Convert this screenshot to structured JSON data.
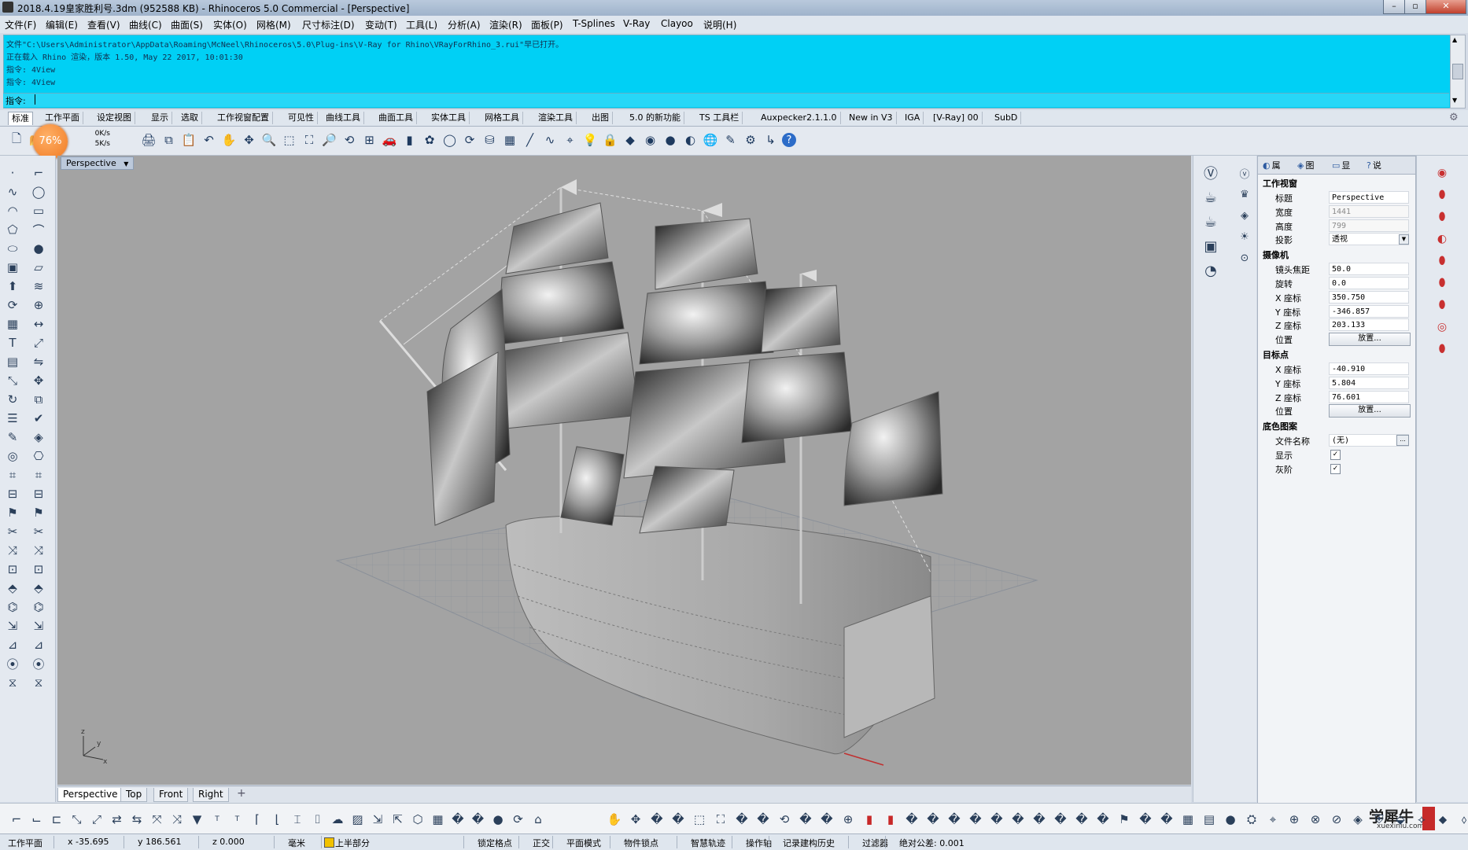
{
  "window": {
    "title": "2018.4.19皇家胜利号.3dm (952588 KB) - Rhinoceros 5.0 Commercial - [Perspective]",
    "controls": [
      "–",
      "▫",
      "✕"
    ]
  },
  "menu": [
    "文件(F)",
    "编辑(E)",
    "查看(V)",
    "曲线(C)",
    "曲面(S)",
    "实体(O)",
    "网格(M)",
    "尺寸标注(D)",
    "变动(T)",
    "工具(L)",
    "分析(A)",
    "渲染(R)",
    "面板(P)",
    "T-Splines",
    "V-Ray",
    "Clayoo",
    "说明(H)"
  ],
  "command": {
    "history": [
      "文件\"C:\\Users\\Administrator\\AppData\\Roaming\\McNeel\\Rhinoceros\\5.0\\Plug-ins\\V-Ray for Rhino\\VRayForRhino_3.rui\"早已打开。",
      "正在载入 Rhino 渲染，版本 1.50, May 22 2017, 10:01:30",
      "指令: 4View",
      "指令: 4View"
    ],
    "prompt": "指令:"
  },
  "toolbar_tabs": [
    "标准",
    "工作平面",
    "设定视图",
    "显示",
    "选取",
    "工作视窗配置",
    "可见性",
    "曲线工具",
    "曲面工具",
    "实体工具",
    "网格工具",
    "渲染工具",
    "出图",
    "5.0 的新功能",
    "TS 工具栏",
    "Auxpecker2.1.1.0",
    "New in V3",
    "IGA",
    "[V-Ray] 00",
    "SubD"
  ],
  "active_tab": "标准",
  "net_speed": {
    "up": "0K/s",
    "down": "5K/s"
  },
  "gpu_badge": "76%",
  "viewport": {
    "label": "Perspective",
    "tabs": [
      "Perspective",
      "Top",
      "Front",
      "Right"
    ],
    "active": "Perspective",
    "axis_labels": {
      "z": "z",
      "y": "y",
      "x": "x"
    }
  },
  "properties": {
    "tabs": [
      "属",
      "图",
      "显",
      "说"
    ],
    "sections": [
      {
        "title": "工作视窗",
        "rows": [
          {
            "key": "标题",
            "value": "Perspective",
            "kind": "text"
          },
          {
            "key": "宽度",
            "value": "1441",
            "kind": "gray"
          },
          {
            "key": "高度",
            "value": "799",
            "kind": "gray"
          },
          {
            "key": "投影",
            "value": "透视",
            "kind": "select"
          }
        ]
      },
      {
        "title": "摄像机",
        "rows": [
          {
            "key": "镜头焦距",
            "value": "50.0",
            "kind": "text"
          },
          {
            "key": "旋转",
            "value": "0.0",
            "kind": "text"
          },
          {
            "key": "X 座标",
            "value": "350.750",
            "kind": "text"
          },
          {
            "key": "Y 座标",
            "value": "-346.857",
            "kind": "text"
          },
          {
            "key": "Z 座标",
            "value": "203.133",
            "kind": "text"
          },
          {
            "key": "位置",
            "value": "放置...",
            "kind": "button"
          }
        ]
      },
      {
        "title": "目标点",
        "rows": [
          {
            "key": "X 座标",
            "value": "-40.910",
            "kind": "text"
          },
          {
            "key": "Y 座标",
            "value": "5.804",
            "kind": "text"
          },
          {
            "key": "Z 座标",
            "value": "76.601",
            "kind": "text"
          },
          {
            "key": "位置",
            "value": "放置...",
            "kind": "button"
          }
        ]
      },
      {
        "title": "底色图案",
        "rows": [
          {
            "key": "文件名称",
            "value": "(无)",
            "kind": "file"
          },
          {
            "key": "显示",
            "value": "✓",
            "kind": "check"
          },
          {
            "key": "灰阶",
            "value": "✓",
            "kind": "check"
          }
        ]
      }
    ]
  },
  "status": {
    "items": [
      "工作平面",
      "x -35.695",
      "y 186.561",
      "z 0.000",
      "毫米",
      "上半部分",
      "锁定格点",
      "正交",
      "平面模式",
      "物件锁点",
      "智慧轨迹",
      "操作轴",
      "记录建构历史",
      "过滤器",
      "绝对公差: 0.001"
    ],
    "layer_color": "#f2c200"
  },
  "watermark": {
    "text": "学犀牛",
    "sub": "xuexiniu.com"
  },
  "icons": {
    "main_toolbar": [
      "new-file-icon",
      "open-icon",
      "save-icon",
      "print-icon",
      "copy-icon",
      "paste-icon",
      "undo-icon",
      "pan-hand-icon",
      "rotate-view-icon",
      "zoom-icon",
      "zoom-window-icon",
      "zoom-extents-icon",
      "zoom-selected-icon",
      "undo-view-icon",
      "four-view-icon",
      "car-icon",
      "person-icon",
      "render-icon",
      "circle-icon",
      "refresh-icon",
      "cylinder-icon",
      "grid-icon",
      "line-icon",
      "curve-icon",
      "snap-icon",
      "bulb-icon",
      "lock-icon",
      "material-icon",
      "color-wheel-icon",
      "sphere-icon",
      "shade-icon",
      "globe-icon",
      "paint-icon",
      "gear-icon",
      "arrow-icon",
      "help-icon"
    ]
  }
}
